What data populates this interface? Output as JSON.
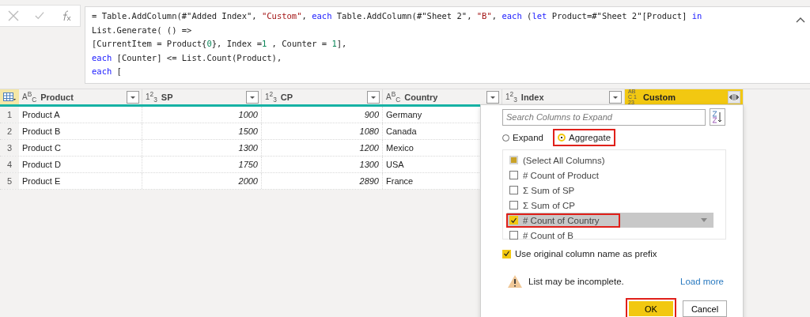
{
  "formula_bar": {
    "lines": [
      [
        {
          "kind": "plain",
          "text": "= Table.AddColumn(#\"Added Index\", "
        },
        {
          "kind": "string",
          "text": "\"Custom\""
        },
        {
          "kind": "plain",
          "text": ", "
        },
        {
          "kind": "keyword",
          "text": "each"
        },
        {
          "kind": "plain",
          "text": " Table.AddColumn(#\"Sheet 2\", "
        },
        {
          "kind": "string",
          "text": "\"B\""
        },
        {
          "kind": "plain",
          "text": ", "
        },
        {
          "kind": "keyword",
          "text": "each"
        },
        {
          "kind": "plain",
          "text": " ("
        },
        {
          "kind": "keyword",
          "text": "let"
        },
        {
          "kind": "plain",
          "text": " Product=#\"Sheet 2\"[Product] "
        },
        {
          "kind": "keyword",
          "text": "in"
        }
      ],
      [
        {
          "kind": "plain",
          "text": "List.Generate( () =>"
        }
      ],
      [
        {
          "kind": "plain",
          "text": "[CurrentItem = Product{"
        },
        {
          "kind": "number",
          "text": "0"
        },
        {
          "kind": "plain",
          "text": "}, Index ="
        },
        {
          "kind": "number",
          "text": "1"
        },
        {
          "kind": "plain",
          "text": " , Counter = "
        },
        {
          "kind": "number",
          "text": "1"
        },
        {
          "kind": "plain",
          "text": "],"
        }
      ],
      [
        {
          "kind": "keyword",
          "text": "each"
        },
        {
          "kind": "plain",
          "text": " [Counter] <= List.Count(Product),"
        }
      ],
      [
        {
          "kind": "keyword",
          "text": "each"
        },
        {
          "kind": "plain",
          "text": " ["
        }
      ]
    ]
  },
  "table": {
    "columns": [
      {
        "name": "Product",
        "kind": "text",
        "type_icon": "A$^{B}$$_{C}$",
        "selected": false
      },
      {
        "name": "SP",
        "kind": "number",
        "type_icon": "1$^{2}$$_{3}$",
        "selected": false
      },
      {
        "name": "CP",
        "kind": "number",
        "type_icon": "1$^{2}$$_{3}$",
        "selected": false
      },
      {
        "name": "Country",
        "kind": "text",
        "type_icon": "A$^{B}$$_{C}$",
        "selected": false
      },
      {
        "name": "Index",
        "kind": "number",
        "type_icon": "1$^{2}$$_{3}$",
        "selected": false
      },
      {
        "name": "Custom",
        "kind": "any",
        "type_icon": "ABC 123",
        "selected": true
      }
    ],
    "rows": [
      {
        "number": "1",
        "cells": [
          "Product A",
          "1000",
          "900",
          "Germany"
        ]
      },
      {
        "number": "2",
        "cells": [
          "Product B",
          "1500",
          "1080",
          "Canada"
        ]
      },
      {
        "number": "3",
        "cells": [
          "Product C",
          "1300",
          "1200",
          "Mexico"
        ]
      },
      {
        "number": "4",
        "cells": [
          "Product D",
          "1750",
          "1300",
          "USA"
        ]
      },
      {
        "number": "5",
        "cells": [
          "Product E",
          "2000",
          "2890",
          "France"
        ]
      }
    ]
  },
  "expand_popup": {
    "search": {
      "placeholder": "Search Columns to Expand"
    },
    "modes": [
      {
        "label": "Expand",
        "selected": false,
        "annotated": false
      },
      {
        "label": "Aggregate",
        "selected": true,
        "annotated": true
      }
    ],
    "items": [
      {
        "label": "(Select All Columns)",
        "kind": "select-all",
        "checked": false,
        "hovered": false,
        "annotated": false
      },
      {
        "label": "# Count of Product",
        "kind": "column",
        "checked": false,
        "hovered": false,
        "annotated": false
      },
      {
        "label": "Σ Sum of SP",
        "kind": "column",
        "checked": false,
        "hovered": false,
        "annotated": false
      },
      {
        "label": "Σ Sum of CP",
        "kind": "column",
        "checked": false,
        "hovered": false,
        "annotated": false
      },
      {
        "label": "# Count of Country",
        "kind": "column",
        "checked": true,
        "hovered": true,
        "annotated": true
      },
      {
        "label": "# Count of B",
        "kind": "column",
        "checked": false,
        "hovered": false,
        "annotated": false
      }
    ],
    "prefix": {
      "label": "Use original column name as prefix",
      "checked": true
    },
    "warning": "List may be incomplete.",
    "load_more": "Load more",
    "buttons": [
      {
        "label": "OK",
        "kind": "primary",
        "annotated": true
      },
      {
        "label": "Cancel",
        "kind": "secondary",
        "annotated": false
      }
    ]
  }
}
